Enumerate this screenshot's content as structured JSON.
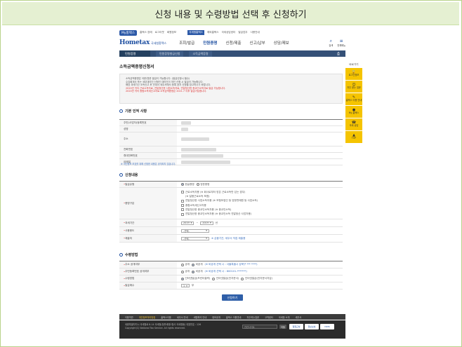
{
  "instruction_banner": "신청 내용 및 수령방법 선택 후 신청하기",
  "topbar": {
    "my_label": "My홈택스",
    "links": [
      "홈택스 장애",
      "로그아웃",
      "회원정보",
      "...",
      "해외홈택스",
      "국세상담센터",
      "발급업무",
      "사용안내"
    ],
    "ribbon": "국세청홈택스"
  },
  "header": {
    "logo_main": "Hometax",
    "logo_sub": "국세청홈택스",
    "menu": [
      "조회/발급",
      "민원증명",
      "신청/제출",
      "신고/납부",
      "상담/제보"
    ],
    "active_menu": "민원증명",
    "icons": [
      {
        "name": "search-icon",
        "glyph": "⌕",
        "label": "검색"
      },
      {
        "name": "menu-icon",
        "glyph": "≡",
        "label": "전체메뉴"
      }
    ]
  },
  "navbar": {
    "home": "민원증명",
    "crumbs": [
      "민원증명발급신청",
      "소득금액증명"
    ],
    "print_glyph": "⎙"
  },
  "sidebar": {
    "title": "바로가기",
    "items": [
      {
        "name": "login-icon",
        "glyph": "🔒",
        "label": "로그인정보"
      },
      {
        "name": "help-icon",
        "glyph": "☺",
        "label": "자주 묻는 질문"
      },
      {
        "name": "guide-icon",
        "glyph": "✎",
        "label": "홈택스 이용 안내"
      },
      {
        "name": "my-icon",
        "glyph": "●",
        "label": "My 홈택스"
      },
      {
        "name": "consult-icon",
        "glyph": "☎",
        "label": "국세 상담"
      },
      {
        "name": "top-icon",
        "glyph": "▲",
        "label": "TOP"
      }
    ]
  },
  "doc_title": "소득금액증명신청서",
  "notices": [
    {
      "text": "소득금액증명은 국문/영문 발급이 가능합니다. (발급신청시 필수)",
      "red": false
    },
    {
      "text": "수임회계사 또는 세무대리인 신청인 대리인이 개인 신청 시 발급이 가능합니다.",
      "red": false
    },
    {
      "text": "해당 과세기간 소득신고 후 안내서 세무서에서 등록 공지 신청을 참고하시기 바랍니다.",
      "red": false
    },
    {
      "text": "2020년 귀속 근로소득자료, 연말정산한 사업소득자료, 연말정산한 종교인소득자료 발급 가능합니다.",
      "red": true
    },
    {
      "text": "2020년 귀속 종합소득세신고자료 소득금액증명은 2021.7 이후 발급가능합니다.",
      "red": true
    }
  ],
  "sections": {
    "basic": "기본 인적 사항",
    "apply": "신청내용",
    "receive": "수령방법"
  },
  "basic_rows": [
    "주민(사업자)등록번호",
    "성명",
    "주소",
    "전화번호",
    "휴대전화번호",
    "이메일"
  ],
  "blue_note": "※ 개인정보 보호를 위해 신청한 내용은 공개되지 않습니다.",
  "apply_rows": {
    "issue_type": {
      "label": "발급유형",
      "options": [
        "한글증명",
        "영문증명"
      ],
      "selected": 0
    },
    "cert_type": {
      "label": "증명구분",
      "options": [
        "근로소득자용 (※ 회사로부터 받은 근로소득만 있는 경우)",
        "(※ 일용근로소득 포함)",
        "연말정산한 사업소득자용 (※ 보험모집인 등 방문판매원 등 사업소득)",
        "종합소득세신고자용",
        "연말정산한 종교인소득자용 (※ 종교인소득)",
        "연말정산한 종교인소득자용 (※ 종교인소득 연말정산 사업자용)"
      ]
    },
    "period": {
      "label": "과세기간",
      "from": "2019",
      "to": "2019",
      "unit": "년"
    },
    "usage": {
      "label": "사용용도",
      "value": "-선택-"
    },
    "submit_to": {
      "label": "제출처",
      "value": "-선택-",
      "hint": "※ 금융기관, 세무서 직접 제출용"
    }
  },
  "receive_rows": {
    "addr_mask": {
      "label": "주소 공개여부",
      "options": [
        "공개",
        "비공개"
      ],
      "selected": 1,
      "hint": "(※ 비공개 선택 시 : 서울특별시 강북구 *** ****)"
    },
    "id_mask": {
      "label": "주민등록번호 공개여부",
      "options": [
        "공개",
        "비공개"
      ],
      "selected": 1,
      "hint": "(※ 비공개 선택 시 : 800101-*******)"
    },
    "method": {
      "label": "수령방법",
      "options": [
        "인터넷발급(프린터출력)",
        "인터넷발급(전자문서)",
        "인터넷발급(전자문서지갑)"
      ],
      "selected": 0
    },
    "count": {
      "label": "발급매수",
      "value": "1",
      "unit": "부"
    }
  },
  "apply_button": "신청하기",
  "footer_nav": [
    "이용약관",
    "개인정보처리방침",
    "홈택스이용",
    "세무서 안내",
    "세법해석 안내",
    "정보공개",
    "홈택스 이용안내",
    "자주하는질문",
    "고객센터",
    "국세청 소개",
    "세무서"
  ],
  "footer_highlight": 1,
  "footer_lines": [
    "세종특별자치시 국세청로 8-14 국세청(정부세종2청사 국세청동) 대표번호 : 126",
    "Copyright(C) National Tax Service. All rights reserved."
  ],
  "footer_select": "관련사이트",
  "footer_go": "이동",
  "footer_marks": [
    "웹접근성",
    "정보보호",
    "ISMS"
  ]
}
